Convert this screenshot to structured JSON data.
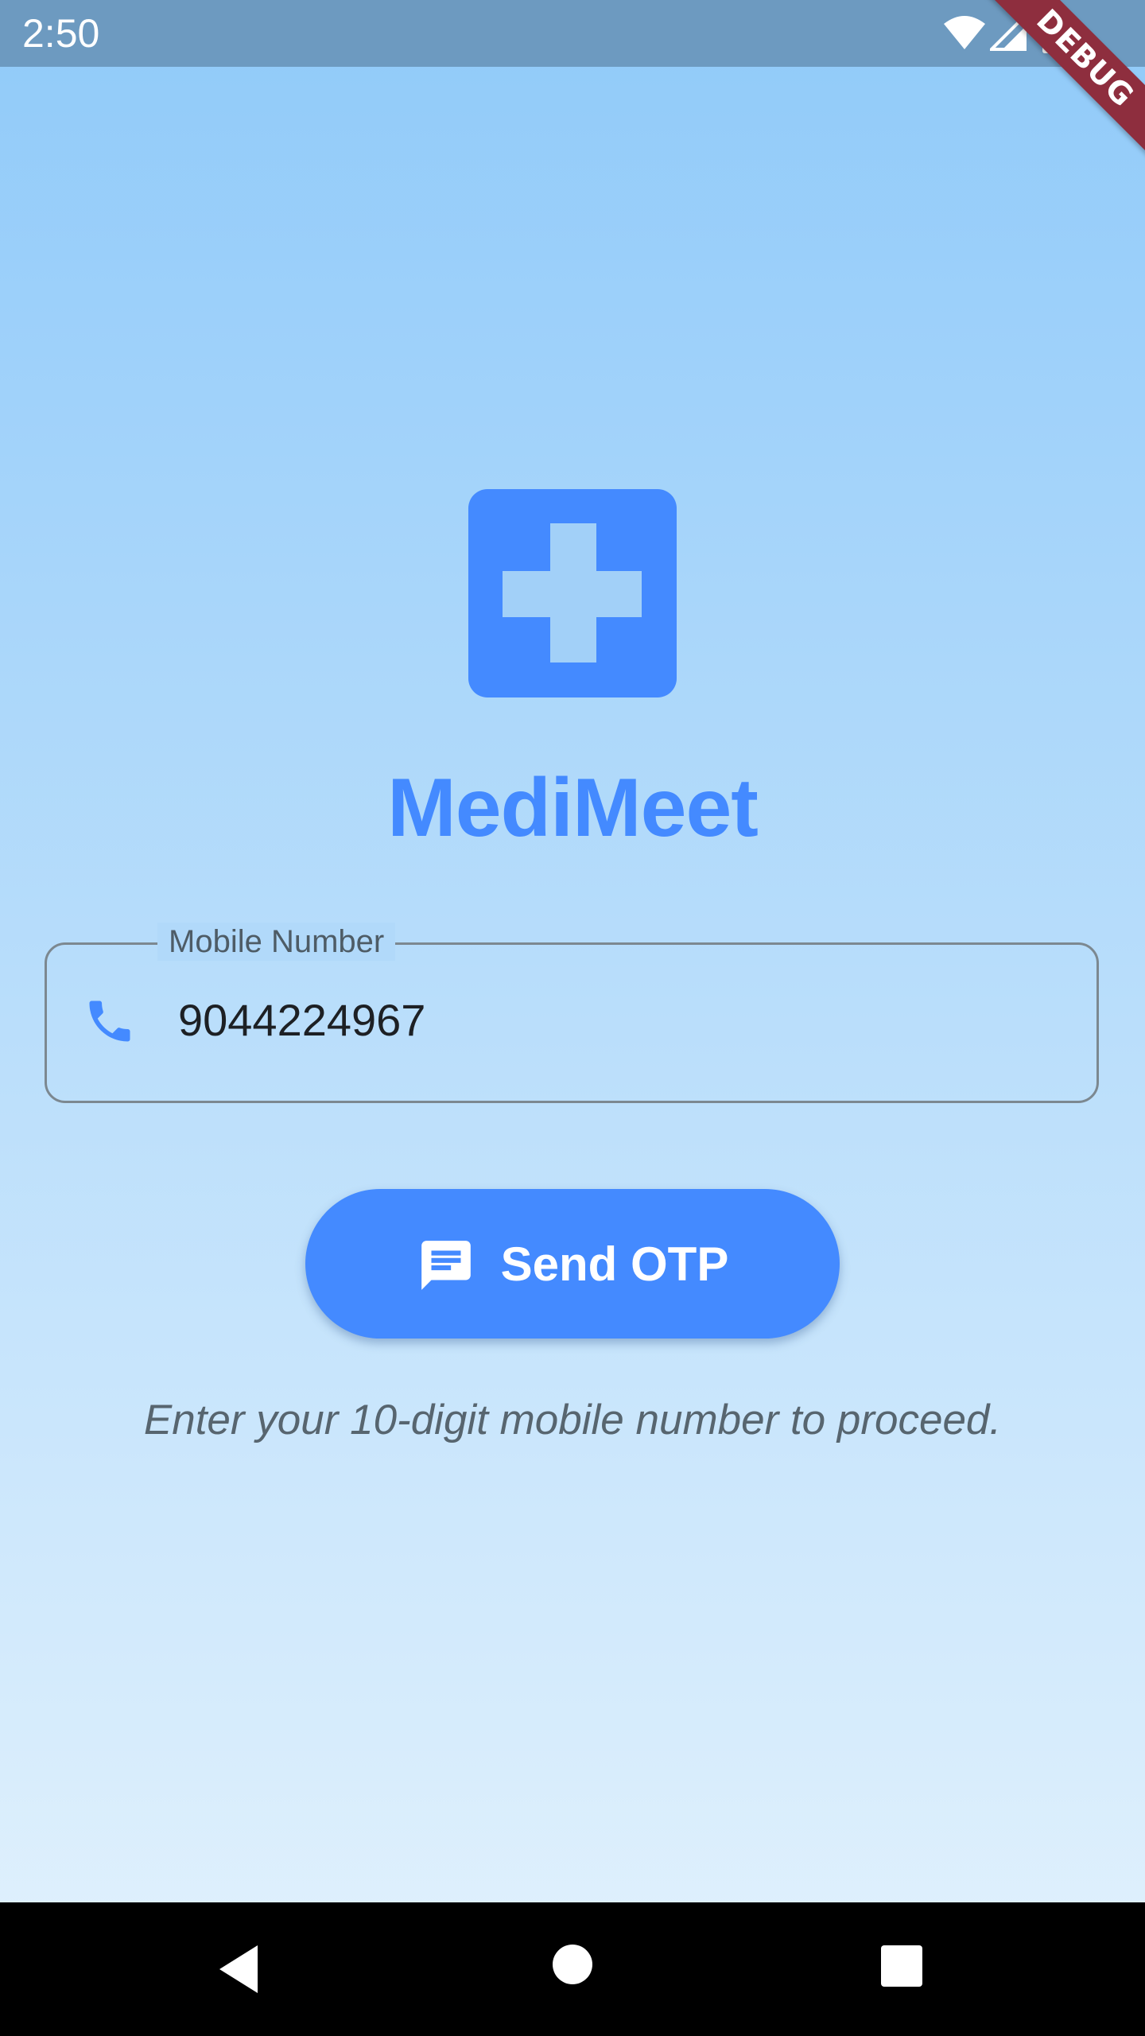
{
  "status_bar": {
    "time": "2:50",
    "icons": [
      "wifi-icon",
      "cellular-signal-icon",
      "battery-icon"
    ]
  },
  "debug_banner": "DEBUG",
  "app": {
    "logo_icon": "medical-cross-icon",
    "title": "MediMeet"
  },
  "mobile_input": {
    "label": "Mobile Number",
    "value": "9044224967",
    "icon": "phone-icon"
  },
  "send_otp": {
    "label": "Send OTP",
    "icon": "chat-icon"
  },
  "hint": "Enter your 10-digit mobile number to proceed.",
  "nav_bar": {
    "buttons": [
      "back-icon",
      "home-icon",
      "recents-icon"
    ]
  },
  "colors": {
    "accent": "#448AFF",
    "status_bar": "#6D9AC0",
    "gradient_top": "#90CAF9",
    "gradient_bottom": "#E3F2FD",
    "debug_banner": "#8E2E3E"
  }
}
